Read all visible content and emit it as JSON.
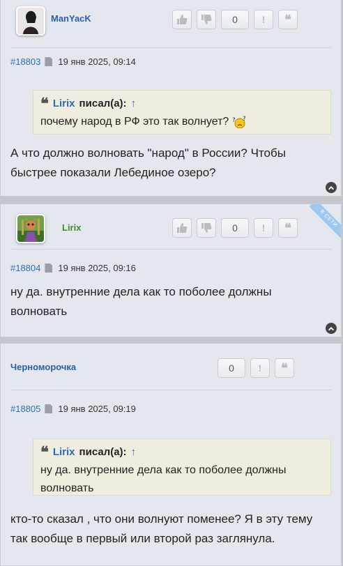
{
  "posts": [
    {
      "username": "ManYacK",
      "username_color": "#2a5fa5",
      "rating_count": "0",
      "post_number": "#18803",
      "date": "19 янв 2025, 09:14",
      "quote_author": "Lirix",
      "quote_said": "писал(а):",
      "quote_arrow": "↑",
      "quote_text": "почему народ в РФ это так волнует?",
      "body": "А что должно волновать \"народ\" в России? Чтобы быстрее показали Лебединое озеро?"
    },
    {
      "username": "Lirix",
      "username_color": "#3c8a2e",
      "rating_count": "0",
      "online_badge": "В СЕТИ",
      "post_number": "#18804",
      "date": "19 янв 2025, 09:16",
      "body": "ну да. внутренние дела как то поболее должны волновать"
    },
    {
      "username": "Черноморочка",
      "username_color": "#2a5fa5",
      "rating_count": "0",
      "post_number": "#18805",
      "date": "19 янв 2025, 09:19",
      "quote_author": "Lirix",
      "quote_said": "писал(а):",
      "quote_arrow": "↑",
      "quote_text": "ну да. внутренние дела как то поболее должны волновать",
      "body": "кто-то сказал , что они волнуют поменее? Я в эту тему так вообще в первый или второй раз заглянула."
    }
  ],
  "icons": {
    "like": "thumbs-up-icon",
    "dislike": "thumbs-down-icon",
    "report": "exclamation-icon",
    "quote": "quote-icon",
    "post": "document-icon",
    "top": "chevron-up-icon"
  }
}
